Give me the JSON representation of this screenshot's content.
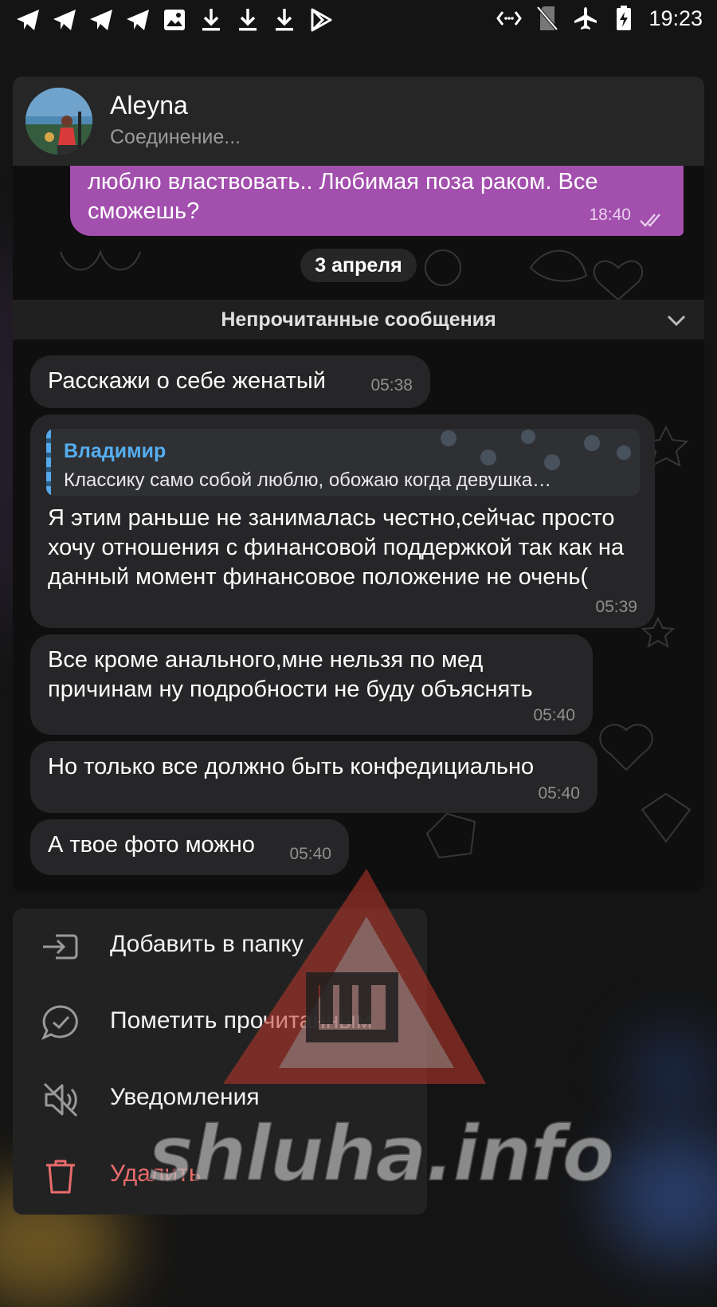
{
  "status_bar": {
    "time": "19:23",
    "left_icons": [
      "telegram-icon",
      "telegram-icon",
      "telegram-icon",
      "telegram-icon",
      "image-icon",
      "download-icon",
      "download-icon",
      "download-icon",
      "play-store-icon"
    ],
    "right_icons": [
      "code-icon",
      "no-sim-icon",
      "airplane-icon",
      "battery-charging-icon"
    ]
  },
  "chat": {
    "name": "Aleyna",
    "status": "Соединение...",
    "outgoing_message": {
      "text": "люблю властвовать.. Любимая поза раком. Все сможешь?",
      "time": "18:40",
      "read_icon": "double-check-icon"
    },
    "date_divider": "3 апреля",
    "unread_bar": "Непрочитанные сообщения",
    "messages": [
      {
        "text": "Расскажи о себе женатый",
        "time": "05:38"
      },
      {
        "reply_name": "Владимир",
        "reply_text": "Классику само собой люблю, обожаю когда девушка…",
        "text": "Я этим раньше не занималась честно,сейчас просто хочу отношения с финансовой поддержкой так как на данный момент финансовое положение не очень(",
        "time": "05:39"
      },
      {
        "text": "Все кроме анального,мне нельзя по мед причинам ну подробности не буду объяснять",
        "time": "05:40"
      },
      {
        "text": "Но только все должно быть конфедициально",
        "time": "05:40"
      },
      {
        "text": "А твое фото можно",
        "time": "05:40"
      }
    ]
  },
  "menu": {
    "items": [
      {
        "label": "Добавить в папку",
        "icon": "folder-add-icon"
      },
      {
        "label": "Пометить прочитанным",
        "icon": "mark-read-icon"
      },
      {
        "label": "Уведомления",
        "icon": "mute-icon"
      },
      {
        "label": "Удалить",
        "icon": "trash-icon"
      }
    ]
  },
  "watermark": {
    "text": "shluha.info",
    "colors": {
      "triangle": "#c0392b",
      "letter": "#2a2a2a"
    }
  },
  "colors": {
    "outgoing_bubble": "#a24fad",
    "incoming_bubble": "#262628",
    "reply_name": "#55aef0",
    "danger": "#e96c6c"
  }
}
